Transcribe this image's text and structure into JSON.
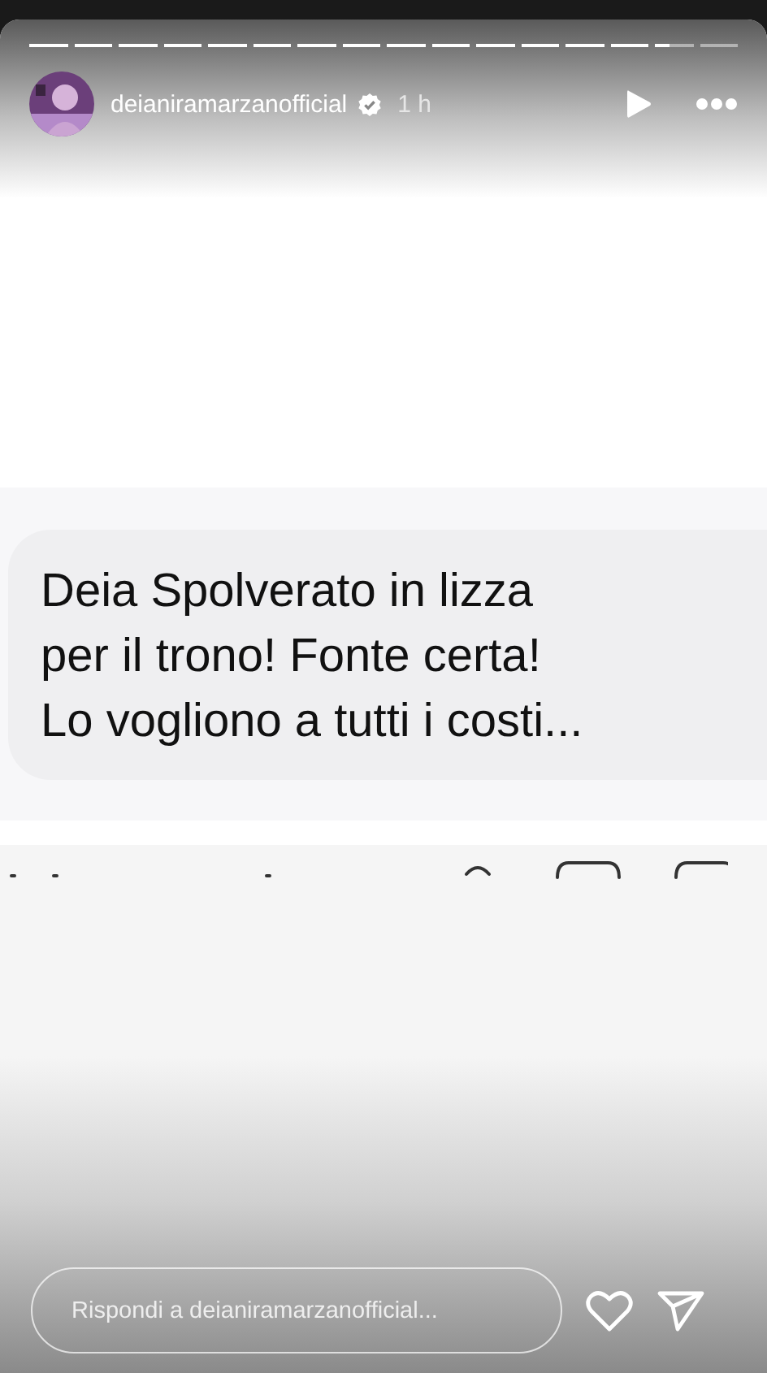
{
  "progress": [
    {
      "level": 1
    },
    {
      "level": 1
    },
    {
      "level": 1
    },
    {
      "level": 1
    },
    {
      "level": 1
    },
    {
      "level": 1
    },
    {
      "level": 1
    },
    {
      "level": 1
    },
    {
      "level": 1
    },
    {
      "level": 1
    },
    {
      "level": 1
    },
    {
      "level": 1
    },
    {
      "level": 1
    },
    {
      "level": 1
    },
    {
      "level": 0.4
    },
    {
      "level": 0
    }
  ],
  "header": {
    "username": "deianiramarzanofficial",
    "verified": true,
    "time": "1 h"
  },
  "message": {
    "lines": [
      "Deia Spolverato in lizza",
      "per il trono! Fonte certa!",
      "Lo vogliono a tutti i costi..."
    ]
  },
  "reply": {
    "placeholder": "Rispondi a deianiramarzanofficial..."
  }
}
